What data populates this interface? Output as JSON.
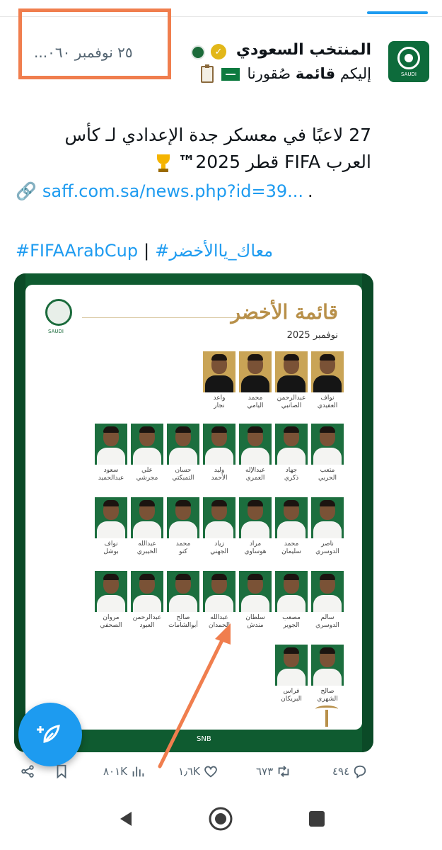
{
  "tweet": {
    "display_name": "المنتخب السعودي",
    "timestamp": "٢٥ نوفمبر ٠٦٠...",
    "subline_prefix": "إليكم ",
    "subline_bold": "قائمة",
    "subline_suffix": " صُقورنا",
    "text_line1": "27 لاعبًا في معسكر جدة الإعدادي لـ كأس",
    "text_line2a": "العرب FIFA قطر 2025",
    "text_tm": "™",
    "link": "saff.com.sa/news.php?id=39...",
    "link_trailing": ".",
    "hashtag1": "#FIFAArabCup",
    "hashtag_sep": "|",
    "hashtag2": "#معاك_ياالأخضر",
    "avatar_label": "SAUDI"
  },
  "media": {
    "title": "قائمة الأخضر",
    "date": "نوفمبر 2025",
    "logo_label": "SAUDI",
    "sponsor": "SNB"
  },
  "players": {
    "row1": [
      "نواف\nالعقيدي",
      "عبدالرحمن\nالصانبي",
      "محمد\nاليامي",
      "واعد\nنجار"
    ],
    "row2": [
      "متعب\nالحربي",
      "جهاد\nذكري",
      "عبدالإله\nالعمري",
      "وليد\nالأحمد",
      "حسان\nالتمبكتي",
      "علي\nمجرشي",
      "سعود\nعبدالحميد"
    ],
    "row3": [
      "ناصر\nالدوسري",
      "محمد\nسليمان",
      "مراد\nهوساوي",
      "زياد\nالجهني",
      "محمد\nكنو",
      "عبدالله\nالخيبري",
      "نواف\nبوشل"
    ],
    "row4": [
      "سالم\nالدوسري",
      "مصعب\nالجوير",
      "سلطان\nمندش",
      "عبدالله\nالحمدان",
      "صالح\nأبوالشامات",
      "عبدالرحمن\nالعبود",
      "مروان\nالصحفي"
    ],
    "row5": [
      "صالح\nالشهري",
      "فراس\nالبريكان"
    ]
  },
  "actions": {
    "replies": "٤٩٤",
    "retweets": "٦٧٣",
    "likes": "١٫٦K",
    "views": "٨٠١K"
  },
  "colors": {
    "accent": "#1d9bf0",
    "highlight": "#f07e4e",
    "saudi_green": "#0f5b30",
    "gold": "#b8904a"
  },
  "icons": {
    "reply": "reply-icon",
    "retweet": "retweet-icon",
    "like": "heart-icon",
    "views": "views-icon",
    "bookmark": "bookmark-icon",
    "share": "share-icon",
    "compose": "compose-icon",
    "back": "back-icon",
    "home": "home-icon",
    "recents": "recents-icon"
  }
}
